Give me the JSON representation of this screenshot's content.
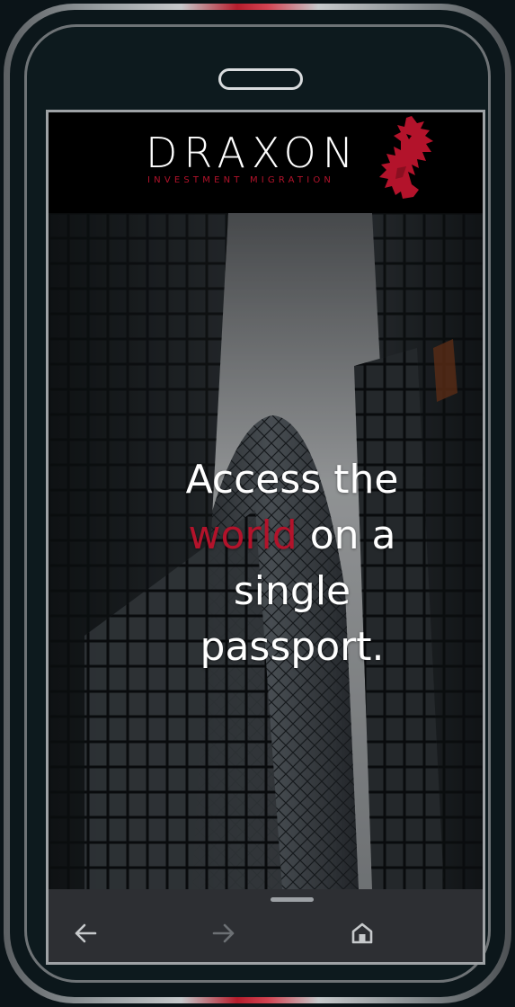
{
  "header": {
    "brand": "DRAXON",
    "tagline": "INVESTMENT MIGRATION",
    "logo_icon": "dragon-icon",
    "colors": {
      "accent": "#b3132b",
      "background": "#000000"
    }
  },
  "hero": {
    "headline": {
      "line1": "Access the",
      "accent_word": "world",
      "line2_rest": " on a",
      "line3": "single",
      "line4": "passport."
    }
  },
  "nav_bar": {
    "back_icon": "arrow-left-icon",
    "forward_icon": "arrow-right-icon",
    "home_icon": "home-icon",
    "forward_enabled": false
  }
}
